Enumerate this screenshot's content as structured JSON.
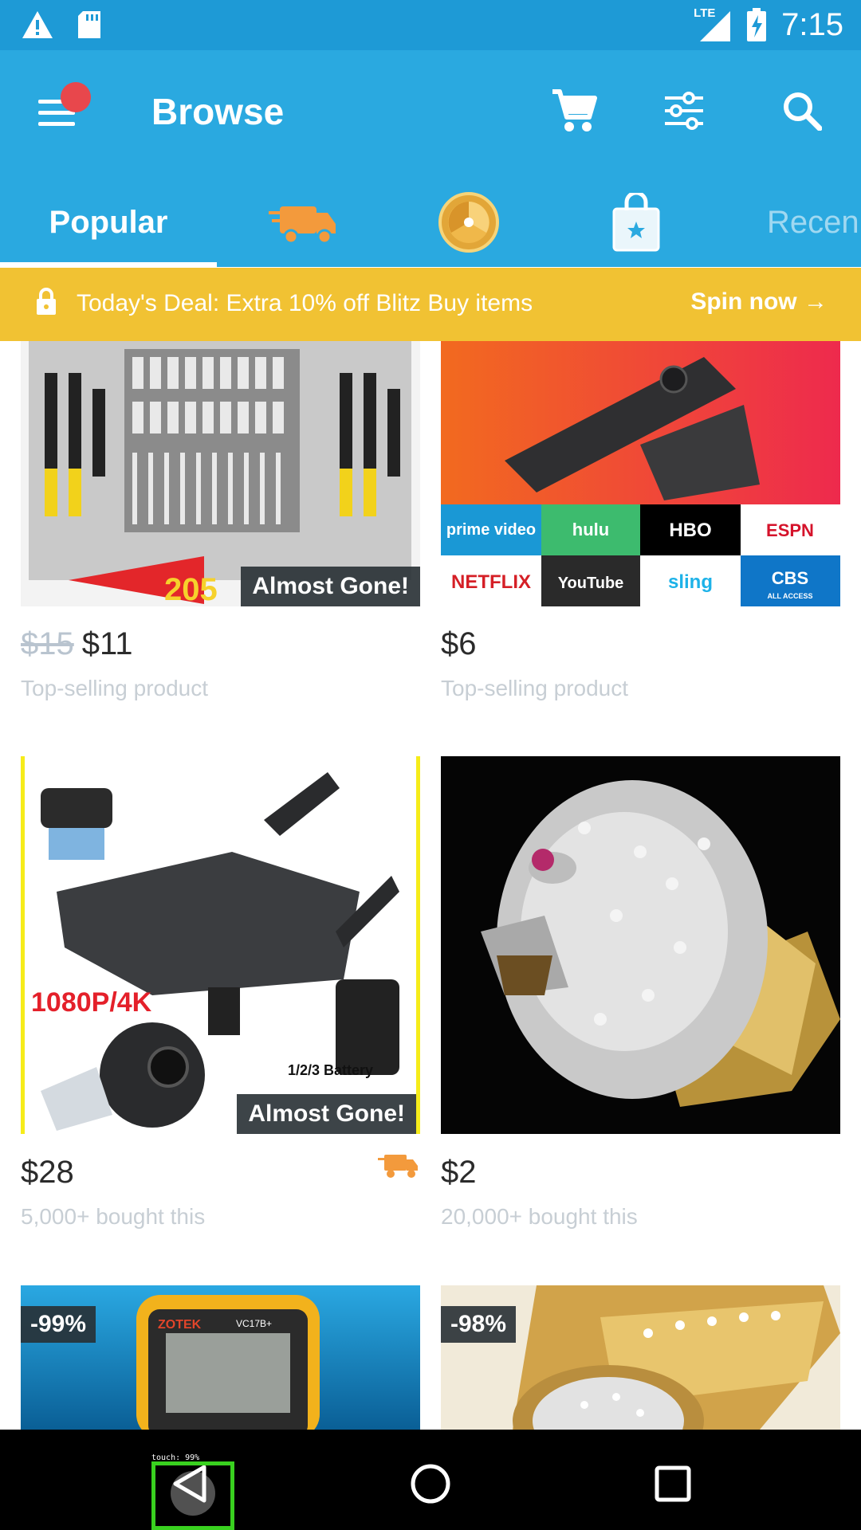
{
  "status_bar": {
    "time": "7:15",
    "network": "LTE"
  },
  "app_bar": {
    "title": "Browse"
  },
  "tabs": [
    {
      "label": "Popular",
      "selected": true
    },
    {
      "icon": "delivery-truck-icon"
    },
    {
      "icon": "spin-wheel-icon"
    },
    {
      "icon": "shopping-bag-star-icon"
    },
    {
      "label": "Recen"
    }
  ],
  "deal": {
    "text": "Today's Deal: Extra 10% off Blitz Buy items",
    "cta": "Spin now"
  },
  "products": [
    {
      "old_price": "$15",
      "price": "$11",
      "subtitle": "Top-selling product",
      "badge": "Almost Gone!",
      "image_text": "205"
    },
    {
      "price": "$6",
      "subtitle": "Top-selling product",
      "logos": [
        "prime video",
        "hulu",
        "HBO",
        "ESPN",
        "NETFLIX",
        "YouTube",
        "sling",
        "CBS"
      ],
      "logo_sub": "ALL ACCESS"
    },
    {
      "price": "$28",
      "subtitle": "5,000+ bought this",
      "badge": "Almost Gone!",
      "image_text_1": "1080P/4K",
      "image_text_2": "1/2/3 Battery"
    },
    {
      "price": "$2",
      "subtitle": "20,000+ bought this"
    },
    {
      "discount": "-99%",
      "image_text": "ZOTEK",
      "image_text_2": "VC17B+"
    },
    {
      "discount": "-98%"
    }
  ],
  "touch_indicator": {
    "label": "touch: 99%"
  },
  "colors": {
    "status": "#1e9ad6",
    "app_bar": "#2aa9e0",
    "deal": "#f1c233",
    "accent_orange": "#f39a3c"
  }
}
